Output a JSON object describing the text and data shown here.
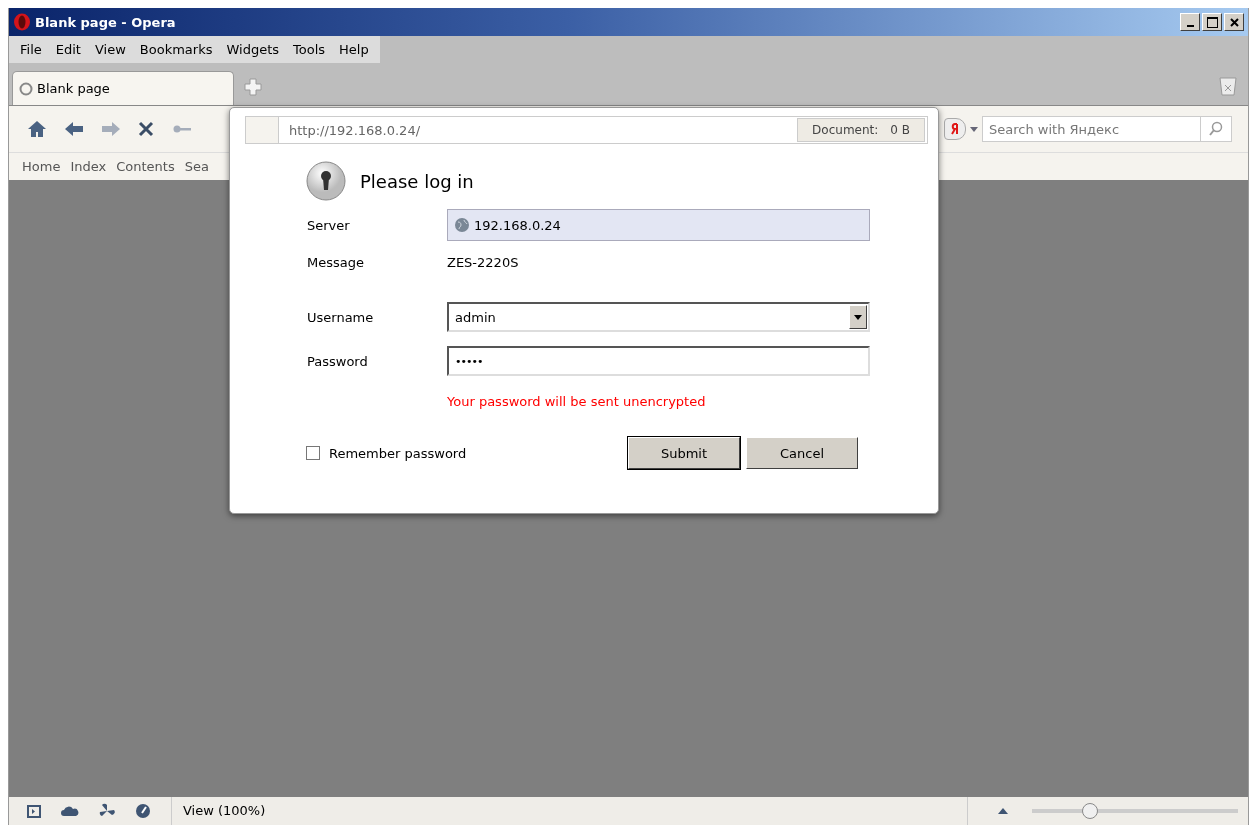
{
  "window": {
    "title": "Blank page - Opera"
  },
  "menu": [
    "File",
    "Edit",
    "View",
    "Bookmarks",
    "Widgets",
    "Tools",
    "Help"
  ],
  "tabs": [
    {
      "label": "Blank page",
      "selected": true
    }
  ],
  "search": {
    "placeholder": "Search with Яндекс"
  },
  "bookmarks": [
    "Home",
    "Index",
    "Contents",
    "Sea"
  ],
  "dialog": {
    "address": "http://192.168.0.24/",
    "document_label": "Document:",
    "document_size": "0 B",
    "title": "Please log in",
    "server": {
      "label": "Server",
      "value": "192.168.0.24"
    },
    "message": {
      "label": "Message",
      "value": "ZES-2220S"
    },
    "username": {
      "label": "Username",
      "value": "admin"
    },
    "password": {
      "label": "Password",
      "value": "•••••"
    },
    "warning": "Your password will be sent unencrypted",
    "remember": {
      "label": "Remember password",
      "checked": false
    },
    "buttons": [
      {
        "label": "Submit",
        "default": true
      },
      {
        "label": "Cancel",
        "default": false
      }
    ]
  },
  "status_bar": {
    "view": "View (100%)",
    "zoom": {
      "level": 0.28
    }
  }
}
